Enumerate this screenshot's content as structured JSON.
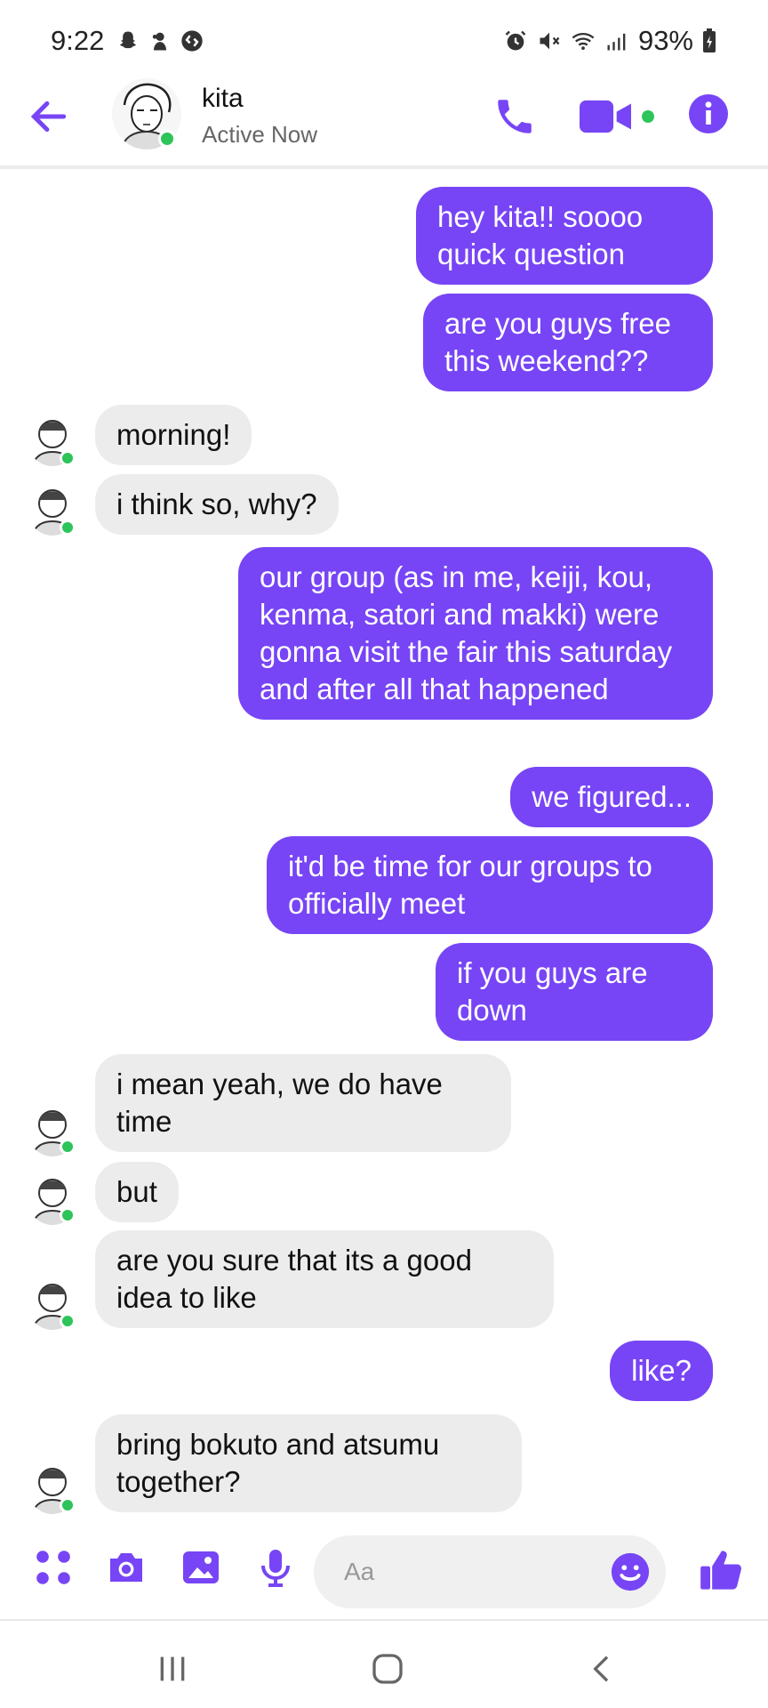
{
  "status_bar": {
    "time": "9:22",
    "battery": "93%",
    "icons": [
      "snapchat-icon",
      "notification-icon",
      "shazam-icon",
      "alarm-icon",
      "mute-icon",
      "wifi-icon",
      "signal-icon",
      "battery-charging-icon"
    ]
  },
  "header": {
    "contact_name": "kita",
    "contact_status": "Active Now",
    "accent": "#7745f5",
    "online_color": "#2dc45a"
  },
  "messages": [
    {
      "side": "out",
      "text": "hey kita!! soooo quick question"
    },
    {
      "side": "out",
      "text": "are you guys free this weekend??"
    },
    {
      "side": "in",
      "text": "morning!"
    },
    {
      "side": "in",
      "text": "i think so, why?"
    },
    {
      "side": "out",
      "text": "our group (as in me, keiji, kou, kenma, satori and makki) were gonna visit the fair this saturday and after all that happened"
    },
    {
      "side": "out",
      "text": "we figured..."
    },
    {
      "side": "out",
      "text": "it'd be time for our groups to officially meet"
    },
    {
      "side": "out",
      "text": "if you guys are down"
    },
    {
      "side": "in",
      "text": "i mean yeah, we do have time"
    },
    {
      "side": "in",
      "text": "but"
    },
    {
      "side": "in",
      "text": "are you sure that its a good idea to like"
    },
    {
      "side": "out",
      "text": "like?"
    },
    {
      "side": "in",
      "text": "bring bokuto and atsumu together?"
    }
  ],
  "composer": {
    "placeholder": "Aa"
  }
}
